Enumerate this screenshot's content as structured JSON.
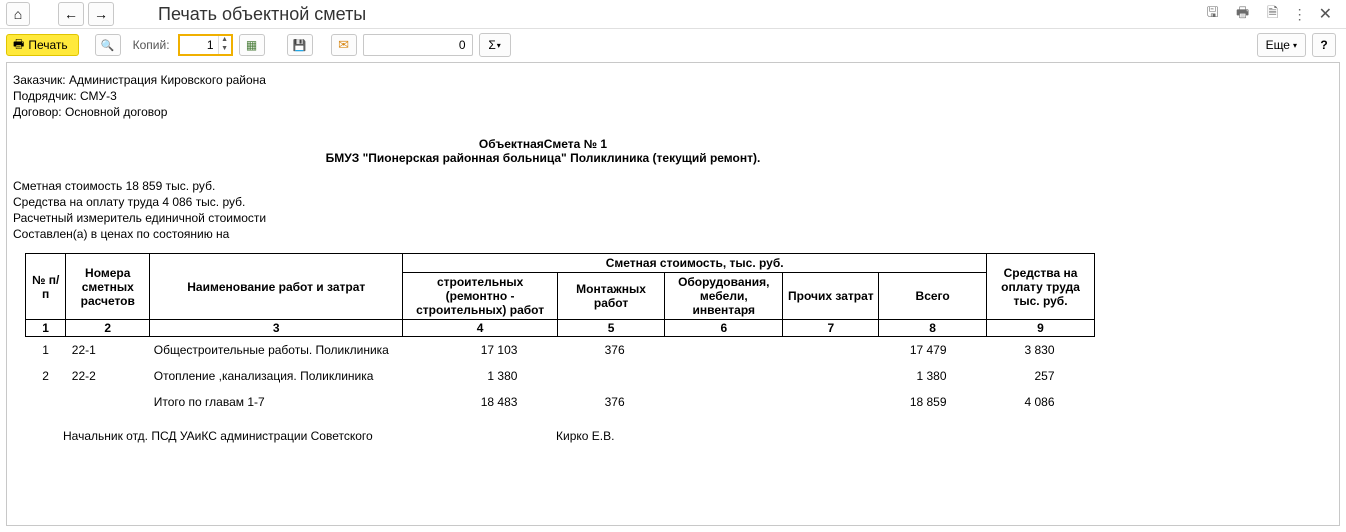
{
  "header": {
    "title": "Печать объектной сметы"
  },
  "toolbar": {
    "print_label": "Печать",
    "copies_label": "Копий:",
    "copies_value": "1",
    "numeric_value": "0",
    "more_label": "Еще",
    "help_label": "?"
  },
  "document": {
    "customer_line": "Заказчик: Администрация Кировского района",
    "contractor_line": "Подрядчик: СМУ-3",
    "contract_line": "Договор: Основной договор",
    "title_line1": "ОбъектнаяСмета № 1",
    "title_line2": "БМУЗ \"Пионерская районная больница\" Поликлиника (текущий ремонт).",
    "summary_cost": "Сметная стоимость  18 859 тыс. руб.",
    "summary_labor": "Средства на оплату труда  4 086 тыс. руб.",
    "summary_unit": "Расчетный измеритель единичной стоимости",
    "summary_prices": "Составлен(а)  в ценах по состоянию на"
  },
  "table": {
    "headers": {
      "idx": "№ п/п",
      "codes": "Номера сметных расчетов",
      "name": "Наименование работ и  затрат",
      "cost_group": "Сметная стоимость, тыс. руб.",
      "build": "строительных (ремонтно - строительных) работ",
      "install": "Монтажных работ",
      "equip": "Оборудования, мебели, инвентаря",
      "other": "Прочих затрат",
      "total": "Всего",
      "labor": "Средства на оплату труда тыс. руб."
    },
    "numrow": [
      "1",
      "2",
      "3",
      "4",
      "5",
      "6",
      "7",
      "8",
      "9"
    ],
    "rows": [
      {
        "idx": "1",
        "code": "22-1",
        "name": "Общестроительные работы. Поликлиника",
        "build": "17 103",
        "install": "376",
        "equip": "",
        "other": "",
        "total": "17 479",
        "labor": "3 830"
      },
      {
        "idx": "2",
        "code": "22-2",
        "name": "Отопление ,канализация. Поликлиника",
        "build": "1 380",
        "install": "",
        "equip": "",
        "other": "",
        "total": "1 380",
        "labor": "257"
      }
    ],
    "totals": {
      "name": "Итого по главам 1-7",
      "build": "18 483",
      "install": "376",
      "equip": "",
      "other": "",
      "total": "18 859",
      "labor": "4 086"
    },
    "sign_title": "Начальник отд. ПСД УАиКС администрации Советского",
    "sign_person": "Кирко Е.В."
  }
}
